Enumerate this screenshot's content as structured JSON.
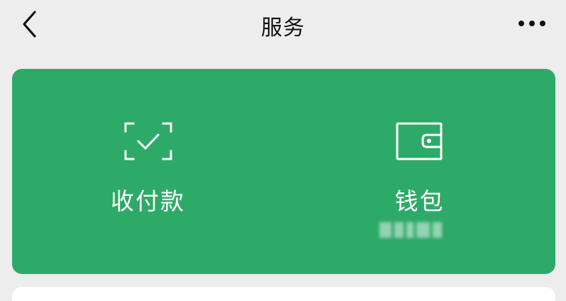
{
  "nav": {
    "title": "服务",
    "back_icon": "chevron-left-icon",
    "more_icon": "more-dots-icon"
  },
  "services": {
    "pay": {
      "label": "收付款",
      "icon": "scan-check-icon"
    },
    "wallet": {
      "label": "钱包",
      "icon": "wallet-icon"
    }
  },
  "colors": {
    "background": "#ededed",
    "card_green": "#2eaa68",
    "text_dark": "#111111",
    "text_light": "#ffffff"
  }
}
